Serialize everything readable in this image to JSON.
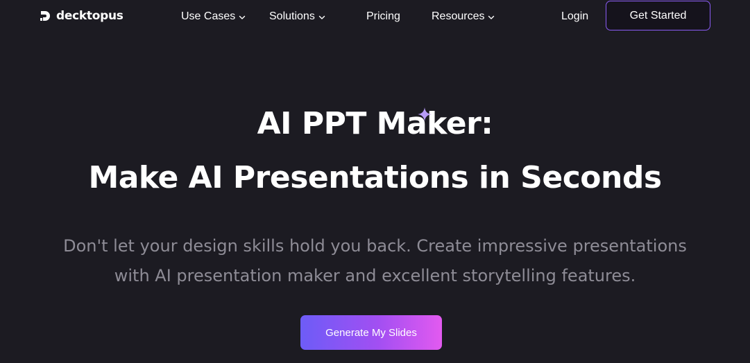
{
  "nav": {
    "logo_text": "decktopus",
    "items": [
      {
        "label": "Use Cases",
        "has_dropdown": true
      },
      {
        "label": "Solutions",
        "has_dropdown": true
      },
      {
        "label": "Pricing",
        "has_dropdown": false
      },
      {
        "label": "Resources",
        "has_dropdown": true
      }
    ],
    "login_label": "Login",
    "cta_label": "Get Started"
  },
  "hero": {
    "title_line_1": "AI PPT Maker:",
    "title_line_2": "Make AI Presentations in Seconds",
    "subtitle_line_1": "Don't let your design skills hold you back. Create impressive presentations",
    "subtitle_line_2": "with AI presentation maker and excellent storytelling features.",
    "cta_label": "Generate My Slides",
    "sparkle_icon": "sparkle-icon"
  },
  "colors": {
    "background": "#1c1b22",
    "text": "#ffffff",
    "subtitle": "#8e8c96",
    "accent_border": "#8b5cf6",
    "gradient_start": "#6d5cf7",
    "gradient_end": "#e25af0",
    "sparkle": "#b79bf7"
  }
}
